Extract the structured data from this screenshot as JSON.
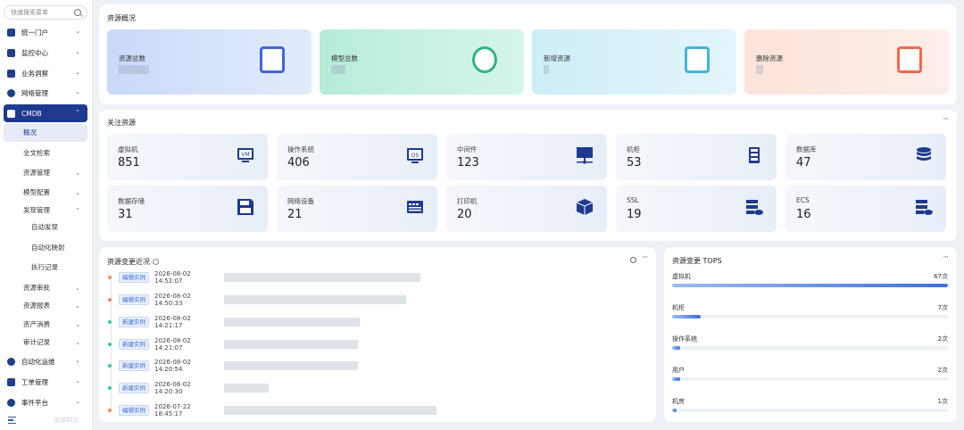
{
  "sidebar": {
    "search_placeholder": "快速搜索菜单",
    "items": [
      {
        "label": "统一门户"
      },
      {
        "label": "监控中心"
      },
      {
        "label": "业务洞察"
      },
      {
        "label": "网络管理"
      },
      {
        "label": "CMDB"
      },
      {
        "label": "自动化运维"
      },
      {
        "label": "工单管理"
      },
      {
        "label": "事件平台"
      }
    ],
    "cmdb_sub": [
      {
        "label": "概况"
      },
      {
        "label": "全文检索"
      },
      {
        "label": "资源管理"
      },
      {
        "label": "模型配置"
      },
      {
        "label": "发现管理"
      },
      {
        "label": "自动发现"
      },
      {
        "label": "自动化映射"
      },
      {
        "label": "执行记录"
      },
      {
        "label": "资源审批"
      },
      {
        "label": "资源报表"
      },
      {
        "label": "资产消费"
      },
      {
        "label": "审计记录"
      }
    ],
    "bottom_text": "运维知识"
  },
  "overview": {
    "title": "资源概况",
    "cards": [
      {
        "label": "资源总数",
        "color": "#d9e4fb"
      },
      {
        "label": "模型总数",
        "color": "#d7f3ea"
      },
      {
        "label": "新增资源",
        "color": "#ddf2fa"
      },
      {
        "label": "删除资源",
        "color": "#fde8e2"
      }
    ]
  },
  "focus": {
    "title": "关注资源",
    "more": "···",
    "tiles": [
      {
        "label": "虚拟机",
        "value": "851",
        "icon": "vm-icon"
      },
      {
        "label": "操作系统",
        "value": "406",
        "icon": "os-icon"
      },
      {
        "label": "中间件",
        "value": "123",
        "icon": "middleware-icon"
      },
      {
        "label": "机柜",
        "value": "53",
        "icon": "cabinet-icon"
      },
      {
        "label": "数据库",
        "value": "47",
        "icon": "database-icon"
      },
      {
        "label": "数据存储",
        "value": "31",
        "icon": "storage-icon"
      },
      {
        "label": "网络设备",
        "value": "21",
        "icon": "network-device-icon"
      },
      {
        "label": "打印机",
        "value": "20",
        "icon": "printer-icon"
      },
      {
        "label": "SSL",
        "value": "19",
        "icon": "ssl-icon"
      },
      {
        "label": "ECS",
        "value": "16",
        "icon": "ecs-icon"
      }
    ]
  },
  "changes": {
    "title": "资源变更近况",
    "more": "···",
    "rows": [
      {
        "tag": "编辑实例",
        "time": "2026-08-02 14:52:07",
        "dot": "#f08a5d"
      },
      {
        "tag": "编辑实例",
        "time": "2026-08-02 14:50:33",
        "dot": "#f08a5d"
      },
      {
        "tag": "新建实例",
        "time": "2026-08-02 14:21:17",
        "dot": "#3cc2a0"
      },
      {
        "tag": "新建实例",
        "time": "2026-08-02 14:21:07",
        "dot": "#3cc2a0"
      },
      {
        "tag": "新建实例",
        "time": "2026-08-02 14:20:54",
        "dot": "#3cc2a0"
      },
      {
        "tag": "新建实例",
        "time": "2026-08-02 14:20:30",
        "dot": "#3cc2a0"
      },
      {
        "tag": "编辑实例",
        "time": "2026-07-22 18:45:17",
        "dot": "#f08a5d"
      }
    ]
  },
  "tops": {
    "title": "资源变更 TOPS",
    "more": "···",
    "rows": [
      {
        "name": "虚拟机",
        "count": "67次",
        "ratio": 1.0
      },
      {
        "name": "机柜",
        "count": "7次",
        "ratio": 0.104
      },
      {
        "name": "操作系统",
        "count": "2次",
        "ratio": 0.03
      },
      {
        "name": "用户",
        "count": "2次",
        "ratio": 0.03
      },
      {
        "name": "机房",
        "count": "1次",
        "ratio": 0.015
      }
    ]
  }
}
